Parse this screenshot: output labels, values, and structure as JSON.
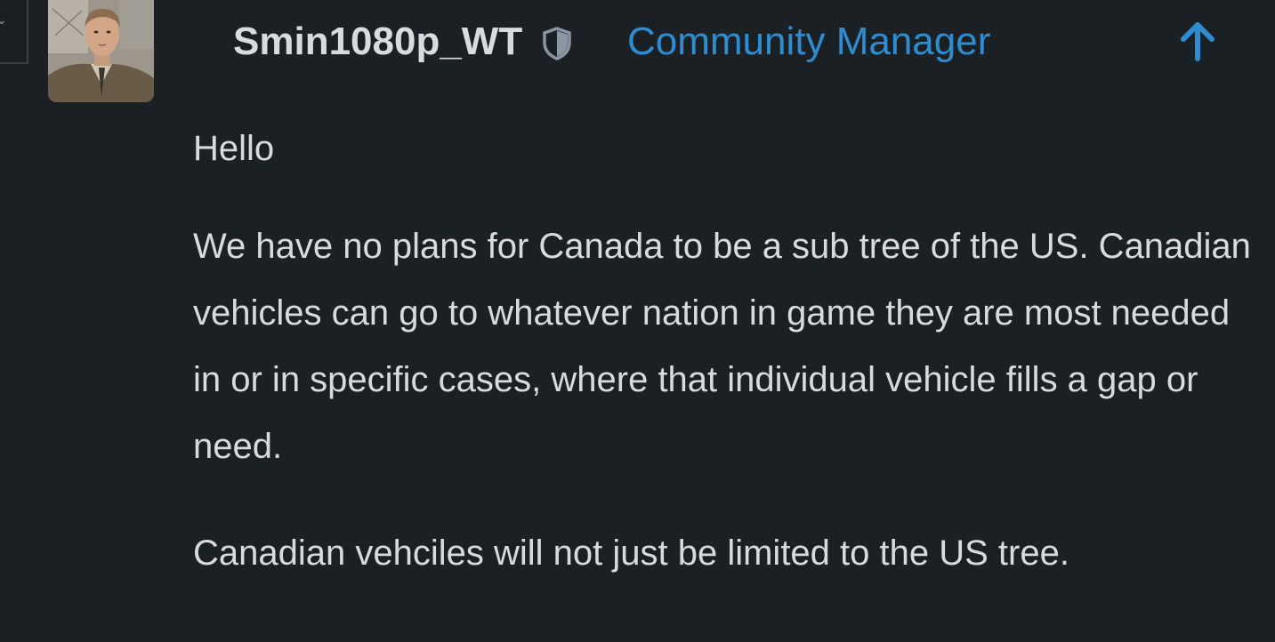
{
  "post": {
    "author": {
      "username": "Smin1080p_WT",
      "title": "Community Manager",
      "moderator_badge_icon": "shield-icon",
      "avatar": "avatar"
    },
    "actions": {
      "scroll_up_icon": "arrow-up-icon"
    },
    "body": {
      "greeting": "Hello",
      "paragraph_1": "We have no plans for Canada to be a sub tree of the US. Canadian vehicles can go to whatever nation in game they are most needed in or in specific cases, where that individual vehicle fills a gap or need.",
      "paragraph_2": "Canadian vehciles will not just be limited to the US tree."
    }
  },
  "colors": {
    "background": "#1b2025",
    "text": "#d8dadd",
    "accent": "#2e8ccf",
    "badge": "#8a96a3"
  }
}
